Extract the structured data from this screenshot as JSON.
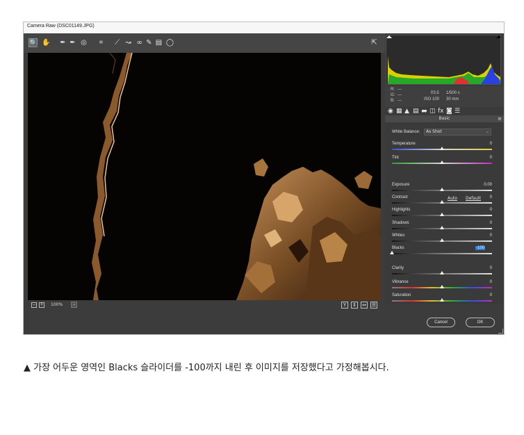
{
  "window": {
    "title": "Camera Raw (DSC01149.JPG)"
  },
  "toolbar": {
    "tools": [
      {
        "name": "zoom-tool",
        "glyph": "🔍",
        "active": true
      },
      {
        "name": "hand-tool",
        "glyph": "✋"
      },
      {
        "name": "white-balance-tool",
        "glyph": "✒"
      },
      {
        "name": "color-sampler-tool",
        "glyph": "✒"
      },
      {
        "name": "targeted-adjustment-tool",
        "glyph": "◎"
      },
      {
        "name": "crop-tool",
        "glyph": "⌗"
      },
      {
        "name": "straighten-tool",
        "glyph": "⟋"
      },
      {
        "name": "spot-removal-tool",
        "glyph": "↝"
      },
      {
        "name": "red-eye-tool",
        "glyph": "∞"
      },
      {
        "name": "adjustment-brush-tool",
        "glyph": "✎"
      },
      {
        "name": "graduated-filter-tool",
        "glyph": "▤"
      },
      {
        "name": "radial-filter-tool",
        "glyph": "◯"
      }
    ],
    "fullscreen_glyph": "⇱"
  },
  "bottom": {
    "zoom_minus": "−",
    "zoom_plus": "+",
    "zoom_level": "100%",
    "zoom_dropdown": "⌄",
    "view_buttons": [
      "Y",
      "⇕",
      "⇔",
      "☰"
    ]
  },
  "info": {
    "r_label": "R:",
    "r_value": "---",
    "g_label": "G:",
    "g_value": "---",
    "b_label": "B:",
    "b_value": "---",
    "aperture": "f/3.5",
    "shutter": "1/500 s",
    "iso": "ISO 100",
    "focal": "30 mm"
  },
  "panel_tabs": [
    "◉",
    "▦",
    "▲",
    "▤",
    "▬",
    "◫",
    "fx",
    "◙",
    "☰"
  ],
  "panel": {
    "title": "Basic",
    "menu": "≡",
    "white_balance_label": "White Balance:",
    "white_balance_value": "As Shot",
    "auto": "Auto",
    "default": "Default"
  },
  "sliders": [
    {
      "label": "Temperature",
      "value": "0",
      "pos": 0.5,
      "track": "temp"
    },
    {
      "label": "Tint",
      "value": "0",
      "pos": 0.5,
      "track": "tint"
    },
    {
      "label": "Exposure",
      "value": "0.00",
      "pos": 0.5,
      "track": "gray"
    },
    {
      "label": "Contrast",
      "value": "0",
      "pos": 0.5,
      "track": "gray"
    },
    {
      "label": "Highlights",
      "value": "0",
      "pos": 0.5,
      "track": "gray"
    },
    {
      "label": "Shadows",
      "value": "0",
      "pos": 0.5,
      "track": "gray"
    },
    {
      "label": "Whites",
      "value": "0",
      "pos": 0.5,
      "track": "gray"
    },
    {
      "label": "Blacks",
      "value": "-100",
      "pos": 0.0,
      "track": "gray",
      "highlight": true
    },
    {
      "label": "Clarity",
      "value": "0",
      "pos": 0.5,
      "track": "gray"
    },
    {
      "label": "Vibrance",
      "value": "0",
      "pos": 0.5,
      "track": "rainbow"
    },
    {
      "label": "Saturation",
      "value": "0",
      "pos": 0.5,
      "track": "rainbow"
    }
  ],
  "buttons": {
    "cancel": "Cancel",
    "ok": "OK"
  },
  "caption": "▲ 가장 어두운 영역인 Blacks 슬라이더를 -100까지 내린 후 이미지를 저장했다고 가정해봅시다."
}
